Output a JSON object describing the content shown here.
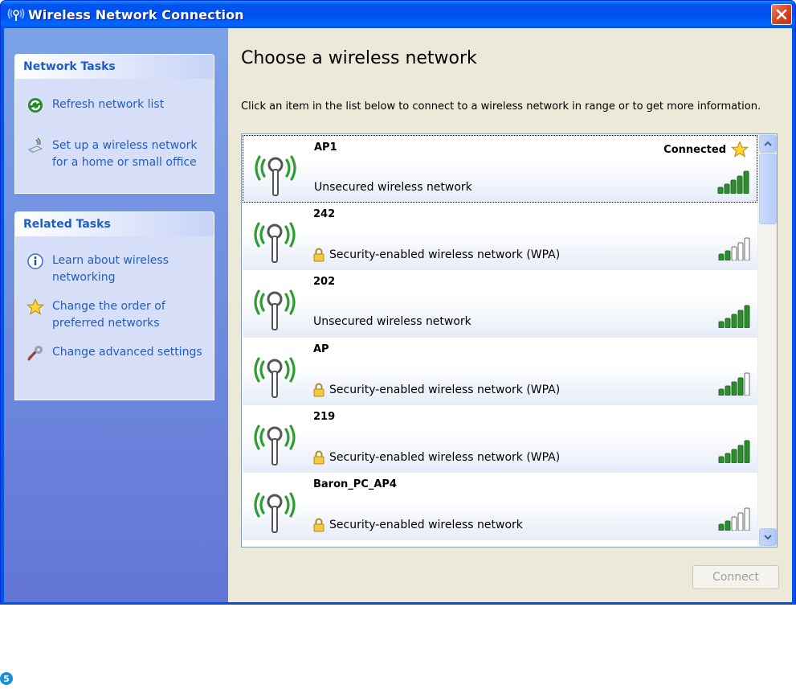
{
  "window": {
    "title": "Wireless Network Connection",
    "icon": "wireless-network-icon",
    "close_icon": "close-icon"
  },
  "colors": {
    "titlebar": "#0053ee",
    "taskpane": "#6f8fdf",
    "task_link": "#215dc6",
    "signal_bar": "#2e8c2e",
    "client_bg": "#ece9d8"
  },
  "sidebar": {
    "network_tasks": {
      "title": "Network Tasks",
      "items": [
        {
          "label": "Refresh network list",
          "icon": "refresh-icon"
        },
        {
          "label": "Set up a wireless network for a home or small office",
          "icon": "wireless-setup-icon"
        }
      ]
    },
    "related_tasks": {
      "title": "Related Tasks",
      "items": [
        {
          "label": "Learn about wireless networking",
          "icon": "info-icon"
        },
        {
          "label": "Change the order of preferred networks",
          "icon": "star-icon"
        },
        {
          "label": "Change advanced settings",
          "icon": "settings-icon"
        }
      ]
    }
  },
  "main": {
    "heading": "Choose a wireless network",
    "instructions": "Click an item in the list below to connect to a wireless network in range or to get more information.",
    "networks": [
      {
        "ssid": "AP1",
        "description": "Unsecured wireless network",
        "secured": false,
        "status": "Connected",
        "signal_bars": 5,
        "selected": true
      },
      {
        "ssid": "242",
        "description": "Security-enabled wireless network (WPA)",
        "secured": true,
        "status": "",
        "signal_bars": 2
      },
      {
        "ssid": "202",
        "description": "Unsecured wireless network",
        "secured": false,
        "status": "",
        "signal_bars": 5
      },
      {
        "ssid": "AP",
        "description": "Security-enabled wireless network (WPA)",
        "secured": true,
        "status": "",
        "signal_bars": 4
      },
      {
        "ssid": "219",
        "description": "Security-enabled wireless network (WPA)",
        "secured": true,
        "status": "",
        "signal_bars": 5
      },
      {
        "ssid": "Baron_PC_AP4",
        "description": "Security-enabled wireless network",
        "secured": true,
        "status": "",
        "signal_bars": 2
      }
    ],
    "connect_label": "Connect"
  },
  "step_badge": "5"
}
